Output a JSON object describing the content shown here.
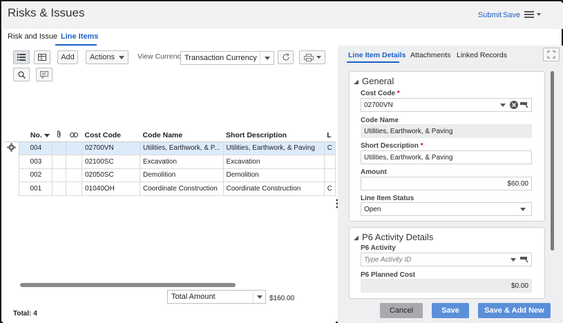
{
  "header": {
    "title": "Risks & Issues",
    "submit": "Submit",
    "save": "Save"
  },
  "tabs": [
    {
      "label": "Risk and Issue"
    },
    {
      "label": "Line Items"
    }
  ],
  "toolbar": {
    "add": "Add",
    "actions": "Actions",
    "view_currency_label": "View Currency",
    "view_currency_value": "Transaction Currency"
  },
  "grid": {
    "columns": [
      "No.",
      "Cost Code",
      "Code Name",
      "Short Description",
      "L"
    ],
    "rows": [
      {
        "no": "004",
        "cost_code": "02700VN",
        "code_name": "Utilities, Earthwork, & P...",
        "short_desc": "Utilities, Earthwork, & Paving",
        "l": "C"
      },
      {
        "no": "003",
        "cost_code": "02100SC",
        "code_name": "Excavation",
        "short_desc": "Excavation",
        "l": ""
      },
      {
        "no": "002",
        "cost_code": "02050SC",
        "code_name": "Demolition",
        "short_desc": "Demolition",
        "l": ""
      },
      {
        "no": "001",
        "cost_code": "01040OH",
        "code_name": "Coordinate Construction",
        "short_desc": "Coordinate Construction",
        "l": "C"
      }
    ]
  },
  "footer": {
    "total_amount_label": "Total Amount",
    "total_amount_value": "$160.00",
    "total_count": "Total: 4"
  },
  "details": {
    "tabs": [
      "Line Item Details",
      "Attachments",
      "Linked Records"
    ],
    "general_title": "General",
    "cost_code_label": "Cost Code",
    "cost_code_value": "02700VN",
    "code_name_label": "Code Name",
    "code_name_value": "Utilities, Earthwork, & Paving",
    "short_desc_label": "Short Description",
    "short_desc_value": "Utilities, Earthwork, & Paving",
    "amount_label": "Amount",
    "amount_value": "$60.00",
    "status_label": "Line Item Status",
    "status_value": "Open",
    "p6_title": "P6 Activity Details",
    "p6_activity_label": "P6 Activity",
    "p6_activity_placeholder": "Type Activity ID",
    "p6_cost_label": "P6 Planned Cost",
    "p6_cost_value": "$0.00",
    "required_mark": "*"
  },
  "actions": {
    "cancel": "Cancel",
    "save": "Save",
    "save_add_new": "Save & Add New"
  },
  "colors": {
    "accent": "#1d5fc4",
    "button_blue": "#5b8fd9",
    "row_highlight": "#dcebfa"
  }
}
